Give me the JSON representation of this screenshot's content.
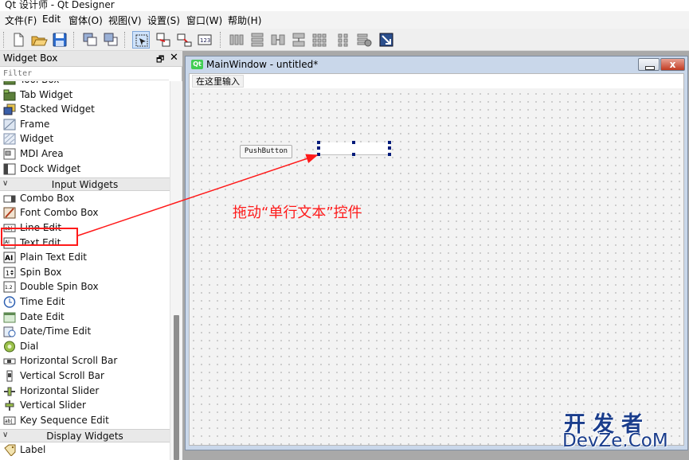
{
  "app": {
    "title": "Qt 设计师 - Qt Designer"
  },
  "menubar": [
    "文件(F)",
    "Edit",
    "窗体(O)",
    "视图(V)",
    "设置(S)",
    "窗口(W)",
    "帮助(H)"
  ],
  "widget_box": {
    "title": "Widget Box",
    "float_glyph": "🗗",
    "close_glyph": "✕",
    "filter_placeholder": "Filter",
    "items": [
      {
        "label": "Tool Box",
        "icon": "tool-box-icon"
      },
      {
        "label": "Tab Widget",
        "icon": "tab-widget-icon"
      },
      {
        "label": "Stacked Widget",
        "icon": "stacked-widget-icon"
      },
      {
        "label": "Frame",
        "icon": "frame-icon"
      },
      {
        "label": "Widget",
        "icon": "widget-icon"
      },
      {
        "label": "MDI Area",
        "icon": "mdi-area-icon"
      },
      {
        "label": "Dock Widget",
        "icon": "dock-widget-icon"
      },
      {
        "category": "Input Widgets"
      },
      {
        "label": "Combo Box",
        "icon": "combo-box-icon"
      },
      {
        "label": "Font Combo Box",
        "icon": "font-combo-box-icon"
      },
      {
        "label": "Line Edit",
        "icon": "line-edit-icon"
      },
      {
        "label": "Text Edit",
        "icon": "text-edit-icon"
      },
      {
        "label": "Plain Text Edit",
        "icon": "plain-text-edit-icon"
      },
      {
        "label": "Spin Box",
        "icon": "spin-box-icon"
      },
      {
        "label": "Double Spin Box",
        "icon": "double-spin-box-icon"
      },
      {
        "label": "Time Edit",
        "icon": "time-edit-icon"
      },
      {
        "label": "Date Edit",
        "icon": "date-edit-icon"
      },
      {
        "label": "Date/Time Edit",
        "icon": "date-time-edit-icon"
      },
      {
        "label": "Dial",
        "icon": "dial-icon"
      },
      {
        "label": "Horizontal Scroll Bar",
        "icon": "horizontal-scroll-bar-icon"
      },
      {
        "label": "Vertical Scroll Bar",
        "icon": "vertical-scroll-bar-icon"
      },
      {
        "label": "Horizontal Slider",
        "icon": "horizontal-slider-icon"
      },
      {
        "label": "Vertical Slider",
        "icon": "vertical-slider-icon"
      },
      {
        "label": "Key Sequence Edit",
        "icon": "key-sequence-edit-icon"
      },
      {
        "category": "Display Widgets"
      },
      {
        "label": "Label",
        "icon": "label-icon"
      }
    ]
  },
  "subwindow": {
    "title": "MainWindow - untitled*",
    "icon_text": "Qt",
    "close_glyph": "x",
    "form_menu_item": "在这里输入",
    "pushbutton_label": "PushButton"
  },
  "annotation": {
    "text": "拖动“单行文本”控件",
    "color": "#ff1a1a"
  },
  "watermark": {
    "line1": "开发者",
    "line2": "DevZe.CoM",
    "color": "#1a3d8c"
  },
  "toolbar": [
    "new-file-icon",
    "open-file-icon",
    "save-icon",
    "send-to-back-icon",
    "bring-to-front-icon",
    "edit-widgets-icon",
    "edit-signals-slots-icon",
    "edit-buddies-icon",
    "edit-tab-order-icon",
    "layout-horizontal-icon",
    "layout-vertical-icon",
    "layout-horizontal-splitter-icon",
    "layout-vertical-splitter-icon",
    "layout-grid-icon",
    "layout-form-icon",
    "break-layout-icon",
    "adjust-size-icon"
  ]
}
